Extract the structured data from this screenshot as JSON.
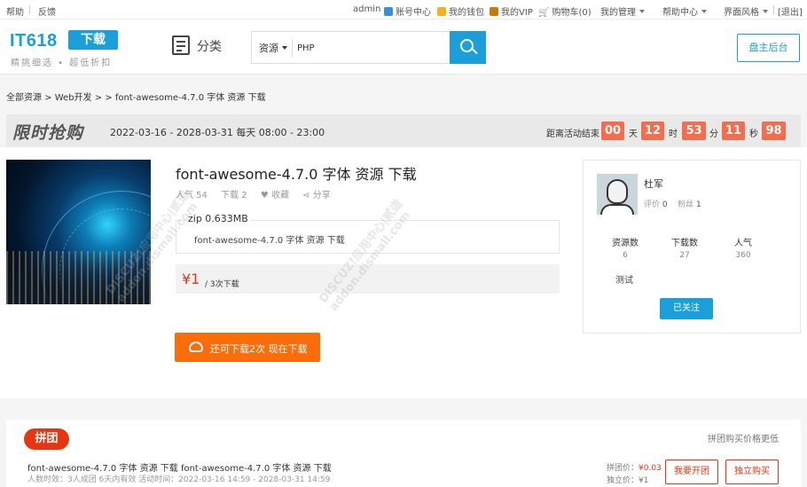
{
  "topbar": {
    "left": [
      "帮助",
      "反馈"
    ],
    "user": "admin",
    "account": "账号中心",
    "wallet": "我的钱包",
    "vip": "我的VIP",
    "cart": "购物车(0)",
    "manage": "我的管理",
    "help_center": "帮助中心",
    "theme": "界面风格",
    "logout": "[退出]"
  },
  "header": {
    "logo_main": "IT618",
    "logo_badge": "下载",
    "logo_tagline": "精挑细选 • 超低折扣",
    "category": "分类",
    "search_scope": "资源",
    "search_value": "PHP",
    "admin_button": "盘主后台"
  },
  "breadcrumb": "全部资源 > Web开发 > > font-awesome-4.7.0 字体 资源 下载",
  "flash": {
    "brand": "限时抢购",
    "period": "2022-03-16 - 2028-03-31 每天 08:00 - 23:00",
    "end_label": "距离活动结束",
    "days": "00",
    "days_unit": "天",
    "hours": "12",
    "hours_unit": "时",
    "minutes": "53",
    "minutes_unit": "分",
    "seconds": "11",
    "seconds_unit": "秒",
    "ms": "98"
  },
  "product": {
    "title": "font-awesome-4.7.0 字体 资源 下载",
    "popularity": "人气 54",
    "downloads": "下载 2",
    "favorite": "♥ 收藏",
    "share": "分享",
    "file_size": "zip 0.633MB",
    "file_name": "font-awesome-4.7.0 字体 资源 下载",
    "price": "¥1",
    "price_sub": "/ 3次下载",
    "download_button": "还可下载2次 现在下载"
  },
  "author": {
    "name": "杜军",
    "rating_label": "评价",
    "rating_value": "0",
    "fans_label": "粉丝",
    "fans_value": "1",
    "stats": [
      {
        "label": "资源数",
        "value": "6"
      },
      {
        "label": "下载数",
        "value": "27"
      },
      {
        "label": "人气",
        "value": "360"
      }
    ],
    "note": "测试",
    "follow_button": "已关注"
  },
  "watermark": {
    "line1": "DISCUZ!应用中心|贰道",
    "line2": "addon.dismall.com"
  },
  "group": {
    "badge": "拼团",
    "more": "拼团购买价格更低",
    "title": "font-awesome-4.7.0 字体 资源 下载 font-awesome-4.7.0 字体 资源 下载",
    "info": "人数时效：3人成团 6天内有效 活动时间：2022-03-16 14:59 - 2028-03-31 14:59",
    "group_price_label": "拼团价：",
    "group_price": "¥0.03",
    "solo_price": "独立价：¥1",
    "open_button": "我要开团",
    "solo_button": "独立购买"
  },
  "colors": {
    "brand_blue": "#1a9fd9",
    "accent_red": "#e8350f",
    "countdown": "#f76c4d",
    "download_orange": "#fa6d0a"
  }
}
